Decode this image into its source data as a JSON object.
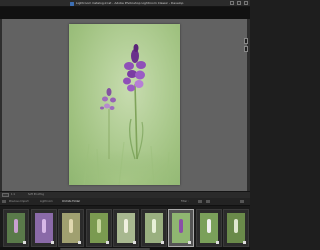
{
  "window": {
    "title": "Lightroom Catalog.lrcat - Adobe Photoshop Lightroom Classic - Develop",
    "app_icon": "lightroom-icon"
  },
  "toolbar": {
    "left_text": "1:1",
    "mid_text": "Soft Proofing"
  },
  "filmstrip_header": {
    "crumbs": [
      "Previous Import",
      "Lightroom",
      "Orchids Folder"
    ],
    "filter_label": "Filter :"
  },
  "filmstrip": {
    "thumbnails": [
      {
        "name": "thumb-1",
        "tone": "#5a7a4a",
        "flower": "#c9a0d0"
      },
      {
        "name": "thumb-2",
        "tone": "#8a6aa8",
        "flower": "#d8b8e8"
      },
      {
        "name": "thumb-3",
        "tone": "#a0a070",
        "flower": "#e0d8b0"
      },
      {
        "name": "thumb-4",
        "tone": "#7a9a50",
        "flower": "#c8d8a0"
      },
      {
        "name": "thumb-5",
        "tone": "#a8b890",
        "flower": "#f0f0e0"
      },
      {
        "name": "thumb-6",
        "tone": "#9ab080",
        "flower": "#e8f0d8"
      },
      {
        "name": "thumb-7",
        "tone": "#8fb671",
        "flower": "#8a4fa8"
      },
      {
        "name": "thumb-8",
        "tone": "#7aa05a",
        "flower": "#f0f0f0"
      },
      {
        "name": "thumb-9",
        "tone": "#6a8a4a",
        "flower": "#e0e8d0"
      }
    ]
  },
  "colors": {
    "orchid_dark": "#6a2f8c",
    "orchid_mid": "#8f4fb8",
    "orchid_light": "#b67fd6",
    "stem": "#7fa35a"
  }
}
